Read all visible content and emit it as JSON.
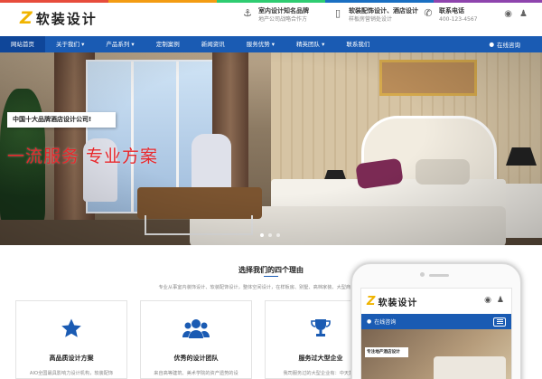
{
  "header": {
    "logo_mark": "Z",
    "logo_text": "软装设计",
    "info": [
      {
        "icon": "anchor-icon",
        "title": "室内设计知名品牌",
        "subtitle": "地产公司战略合作方"
      },
      {
        "icon": "tablet-icon",
        "title": "软装配饰设计、酒店设计",
        "subtitle": "样板房营销处设计"
      },
      {
        "icon": "phone-icon",
        "title": "联系电话",
        "subtitle": "400-123-4567"
      }
    ],
    "social": [
      "weibo-icon",
      "qq-icon"
    ]
  },
  "nav": {
    "items": [
      "网站首页",
      "关于我们 ▾",
      "产品系列 ▾",
      "定制案例",
      "新闻资讯",
      "服务优势 ▾",
      "精英团队 ▾",
      "联系我们"
    ],
    "active_index": 0,
    "consult_label": "在线咨询"
  },
  "hero": {
    "box_text": "中国十大品牌酒店设计公司!",
    "slogan": "一流服务 专业方案",
    "slides": 3,
    "active_slide": 0
  },
  "section": {
    "title": "选择我们的四个理由",
    "desc": "专业从事室内装饰设计、软装配饰设计，整体空间设计，在样板房、别墅、高档家装、大型商业、酒店空间等",
    "cards": [
      {
        "icon": "star-icon",
        "title": "高品质设计方案",
        "desc": "AIO全国最具影响力设计机构，软装配饰"
      },
      {
        "icon": "team-icon",
        "title": "优秀的设计团队",
        "desc": "来自高等建筑、美术学院的资产遗势的设"
      },
      {
        "icon": "trophy-icon",
        "title": "服务过大型企业",
        "desc": "我司服务过的大型企业有：中天集团"
      }
    ]
  },
  "phone": {
    "logo_mark": "Z",
    "logo_text": "软装设计",
    "consult_label": "在线咨询",
    "banner_text": "专注地产酒店设计"
  },
  "colors": {
    "brand_blue": "#1a5bb3",
    "logo_yellow": "#f0b400",
    "slogan_red": "#e8272b"
  }
}
